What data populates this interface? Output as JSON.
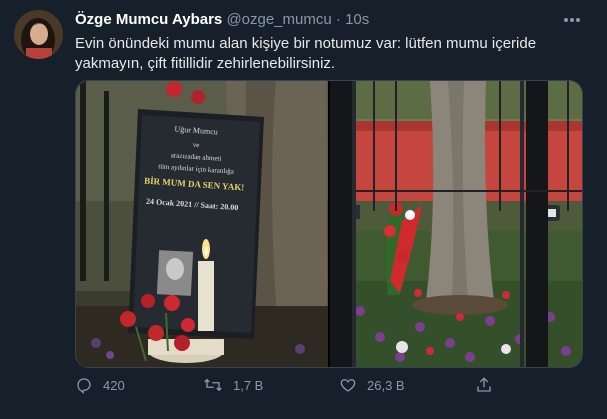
{
  "tweet": {
    "author_name": "Özge Mumcu Aybars",
    "handle": "@ozge_mumcu",
    "separator": "·",
    "time": "10s",
    "text": "Evin önündeki mumu alan kişiye bir notumuz var: lütfen mumu içeride yakmayın, çift fitillidir zehirlenebilirsiniz.",
    "more_icon": "more-horizontal-icon"
  },
  "media": {
    "photo1": {
      "sign_lines": [
        "Uğur Mumcu",
        "ve",
        "arazızadan ahmeti",
        "tüm aydınlar için karanlığa"
      ],
      "sign_slogan": "BİR MUM DA SEN YAK!",
      "sign_date": "24 Ocak 2021 // Saat: 20.00"
    }
  },
  "actions": {
    "reply_count": "420",
    "retweet_count": "1,7 B",
    "like_count": "26,3 B"
  },
  "colors": {
    "background": "#15202b",
    "secondary_text": "#8b98a5",
    "border": "#38444d"
  }
}
